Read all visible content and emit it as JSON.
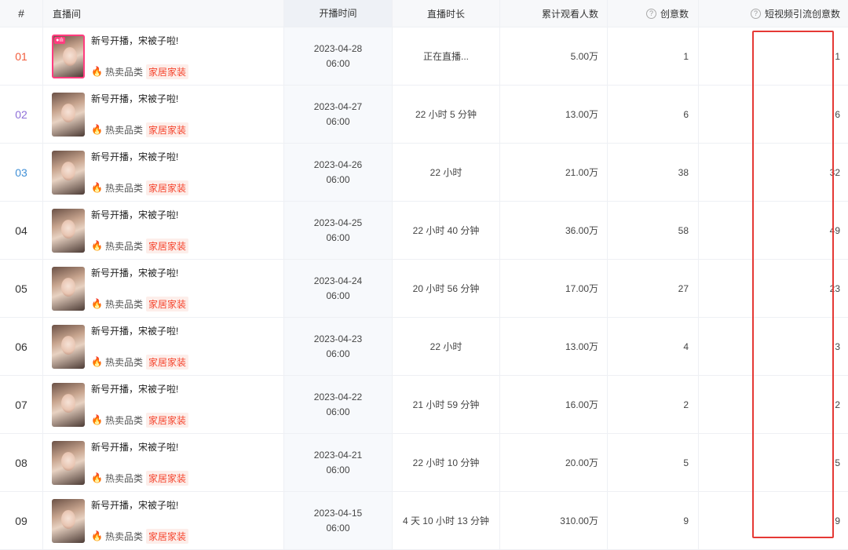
{
  "header": {
    "idx": "#",
    "room": "直播间",
    "start_time": "开播时间",
    "duration": "直播时长",
    "viewers": "累计观看人数",
    "creatives": "创意数",
    "short_video_creatives": "短视频引流创意数",
    "help_icon_glyph": "?"
  },
  "tag_label": "热卖品类",
  "category_label": "家居家装",
  "live_badge_glyph": "●ılı",
  "rows": [
    {
      "idx": "01",
      "idx_color": "#f25c3c",
      "title": "新号开播，宋被子啦!",
      "date": "2023-04-28",
      "time": "06:00",
      "duration": "正在直播...",
      "viewers": "5.00万",
      "creatives": "1",
      "short_creatives": "1",
      "live": true
    },
    {
      "idx": "02",
      "idx_color": "#8e6fd8",
      "title": "新号开播，宋被子啦!",
      "date": "2023-04-27",
      "time": "06:00",
      "duration": "22 小时 5 分钟",
      "viewers": "13.00万",
      "creatives": "6",
      "short_creatives": "6",
      "live": false
    },
    {
      "idx": "03",
      "idx_color": "#3f8fd6",
      "title": "新号开播，宋被子啦!",
      "date": "2023-04-26",
      "time": "06:00",
      "duration": "22 小时",
      "viewers": "21.00万",
      "creatives": "38",
      "short_creatives": "32",
      "live": false
    },
    {
      "idx": "04",
      "idx_color": "#333333",
      "title": "新号开播，宋被子啦!",
      "date": "2023-04-25",
      "time": "06:00",
      "duration": "22 小时 40 分钟",
      "viewers": "36.00万",
      "creatives": "58",
      "short_creatives": "49",
      "live": false
    },
    {
      "idx": "05",
      "idx_color": "#333333",
      "title": "新号开播，宋被子啦!",
      "date": "2023-04-24",
      "time": "06:00",
      "duration": "20 小时 56 分钟",
      "viewers": "17.00万",
      "creatives": "27",
      "short_creatives": "23",
      "live": false
    },
    {
      "idx": "06",
      "idx_color": "#333333",
      "title": "新号开播，宋被子啦!",
      "date": "2023-04-23",
      "time": "06:00",
      "duration": "22 小时",
      "viewers": "13.00万",
      "creatives": "4",
      "short_creatives": "3",
      "live": false
    },
    {
      "idx": "07",
      "idx_color": "#333333",
      "title": "新号开播，宋被子啦!",
      "date": "2023-04-22",
      "time": "06:00",
      "duration": "21 小时 59 分钟",
      "viewers": "16.00万",
      "creatives": "2",
      "short_creatives": "2",
      "live": false
    },
    {
      "idx": "08",
      "idx_color": "#333333",
      "title": "新号开播，宋被子啦!",
      "date": "2023-04-21",
      "time": "06:00",
      "duration": "22 小时 10 分钟",
      "viewers": "20.00万",
      "creatives": "5",
      "short_creatives": "5",
      "live": false
    },
    {
      "idx": "09",
      "idx_color": "#333333",
      "title": "新号开播，宋被子啦!",
      "date": "2023-04-15",
      "time": "06:00",
      "duration": "4 天 10 小时 13 分钟",
      "viewers": "310.00万",
      "creatives": "9",
      "short_creatives": "9",
      "live": false
    }
  ],
  "colors": {
    "highlight_border": "#e53935",
    "category_tag": "#f5452e",
    "live_border": "#ff3d7f"
  }
}
